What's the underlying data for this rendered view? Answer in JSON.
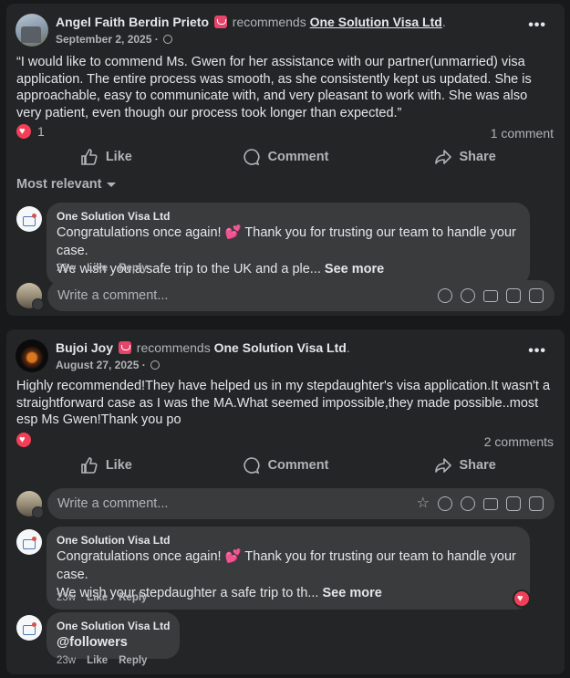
{
  "posts": [
    {
      "author": "Angel Faith Berdin Prieto",
      "recommends_text": "recommends",
      "page": "One Solution Visa Ltd",
      "page_suffix": ".",
      "date": "September 2, 2025 ·",
      "text": "“I would like to commend Ms. Gwen for her assistance with our partner(unmarried) visa application. The entire process was smooth, as she consistently kept us updated. She is approachable, easy to communicate with, and very pleasant to work with. She was also very patient, even though our process took longer than expected.”",
      "reaction_count": "1",
      "comment_count": "1 comment",
      "actions": {
        "like": "Like",
        "comment": "Comment",
        "share": "Share"
      },
      "sort_label": "Most relevant",
      "comments": [
        {
          "author": "One Solution Visa Ltd",
          "line1": "Congratulations once again! 💕 Thank you for trusting our team to handle your case.",
          "line2": "We wish you a safe trip to the UK and a ple...",
          "see_more": "See more",
          "age": "21w",
          "like": "Like",
          "reply": "Reply"
        }
      ],
      "composer_placeholder": "Write a comment..."
    },
    {
      "author": "Bujoi Joy",
      "recommends_text": "recommends",
      "page": "One Solution Visa Ltd",
      "page_suffix": ".",
      "date": "August 27, 2025 ·",
      "text": "Highly recommended!They have helped us in my stepdaughter's visa application.It wasn't a straightforward case as I was the MA.What seemed impossible,they made possible..most esp Ms Gwen!Thank you po",
      "comment_count": "2 comments",
      "actions": {
        "like": "Like",
        "comment": "Comment",
        "share": "Share"
      },
      "composer_placeholder": "Write a comment...",
      "comments": [
        {
          "author": "One Solution Visa Ltd",
          "line1": "Congratulations once again! 💕 Thank you for trusting our team to handle your case.",
          "line2": "We wish your stepdaughter a safe trip to th...",
          "see_more": "See more",
          "age": "23w",
          "like": "Like",
          "reply": "Reply"
        },
        {
          "author": "One Solution Visa Ltd",
          "line1": "@followers",
          "age": "23w",
          "like": "Like",
          "reply": "Reply"
        }
      ]
    }
  ],
  "colors": {
    "background": "#18191a",
    "card": "#242526",
    "bubble": "#3a3b3c",
    "heart": "#f33e58",
    "badge": "#e2466b"
  }
}
